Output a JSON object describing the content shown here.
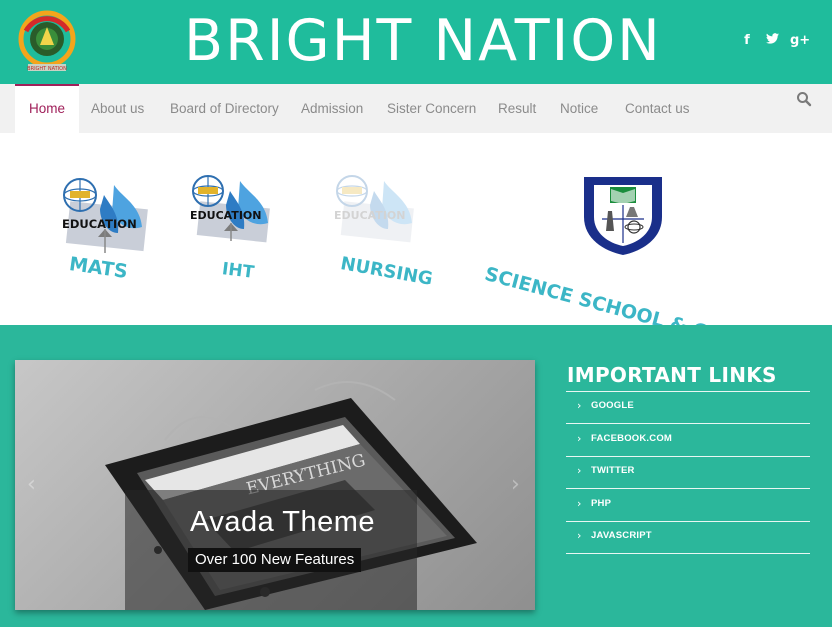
{
  "header": {
    "site_title": "BRIGHT NATION",
    "logo_text": "BRIGHT NATION",
    "social": [
      {
        "icon": "facebook-icon",
        "glyph": "f"
      },
      {
        "icon": "twitter-icon",
        "glyph": "t"
      },
      {
        "icon": "google-plus-icon",
        "glyph": "g+"
      }
    ]
  },
  "nav": {
    "items": [
      {
        "label": "Home",
        "active": true
      },
      {
        "label": "About us"
      },
      {
        "label": "Board of Directory"
      },
      {
        "label": "Admission"
      },
      {
        "label": "Sister Concern"
      },
      {
        "label": "Result"
      },
      {
        "label": "Notice"
      },
      {
        "label": "Contact us"
      }
    ],
    "search_icon": "search-icon"
  },
  "institutions": [
    {
      "badge": "EDUCATION",
      "caption": "MATS"
    },
    {
      "badge": "EDUCATION",
      "caption": "IHT"
    },
    {
      "badge": "EDUCATION",
      "caption": "NURSING"
    },
    {
      "badge": "Bright Nation Science School & College",
      "caption": "SCIENCE SCHOOL & COLLAGE"
    }
  ],
  "slider": {
    "title": "Avada Theme",
    "subtitle": "Over 100 New Features",
    "screen_text": "EVERYTHING",
    "prev_glyph": "‹",
    "next_glyph": "›"
  },
  "important_links": {
    "title": "IMPORTANT LINKS",
    "chevron": "›",
    "items": [
      "GOOGLE",
      "FACEBOOK.COM",
      "TWITTER",
      "PHP",
      "JAVASCRIPT"
    ]
  },
  "colors": {
    "brand_green": "#1fbc9c",
    "accent_magenta": "#a0205a",
    "caption_cyan": "#3cb6c6"
  }
}
